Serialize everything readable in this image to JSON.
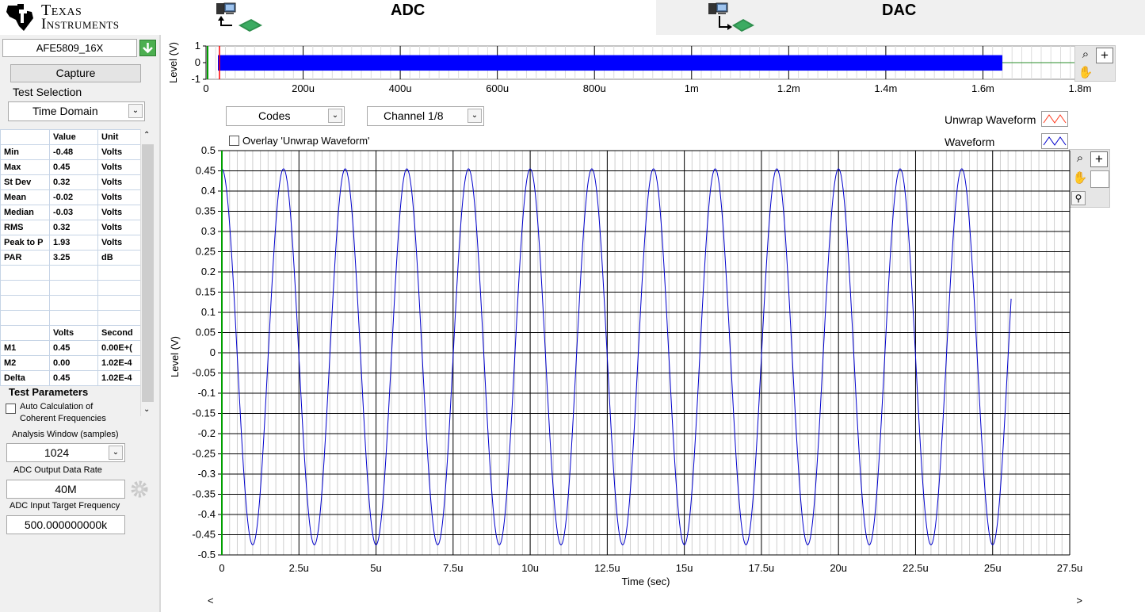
{
  "header": {
    "logo_line1": "Texas",
    "logo_line2": "Instruments",
    "tab_adc": "ADC",
    "tab_dac": "DAC"
  },
  "left_panel": {
    "device": "AFE5809_16X",
    "capture_label": "Capture",
    "test_selection_label": "Test Selection",
    "test_selection_value": "Time Domain",
    "stats_headers": [
      "",
      "Value",
      "Unit"
    ],
    "stats_rows": [
      {
        "name": "Min",
        "value": "-0.48",
        "unit": "Volts"
      },
      {
        "name": "Max",
        "value": "0.45",
        "unit": "Volts"
      },
      {
        "name": "St Dev",
        "value": "0.32",
        "unit": "Volts"
      },
      {
        "name": "Mean",
        "value": "-0.02",
        "unit": "Volts"
      },
      {
        "name": "Median",
        "value": "-0.03",
        "unit": "Volts"
      },
      {
        "name": "RMS",
        "value": "0.32",
        "unit": "Volts"
      },
      {
        "name": "Peak to P",
        "value": "1.93",
        "unit": "Volts"
      },
      {
        "name": "PAR",
        "value": "3.25",
        "unit": "dB"
      }
    ],
    "marker_headers": [
      "",
      "Volts",
      "Second"
    ],
    "marker_rows": [
      {
        "name": "M1",
        "value": "0.45",
        "unit": "0.00E+("
      },
      {
        "name": "M2",
        "value": "0.00",
        "unit": "1.02E-4"
      },
      {
        "name": "Delta",
        "value": "0.45",
        "unit": "1.02E-4"
      }
    ],
    "test_parameters_label": "Test Parameters",
    "auto_calc_line1": "Auto Calculation of",
    "auto_calc_line2": "Coherent Frequencies",
    "analysis_window_label": "Analysis Window (samples)",
    "analysis_window_value": "1024",
    "adc_rate_label": "ADC Output Data Rate",
    "adc_rate_value": "40M",
    "adc_target_label": "ADC Input Target Frequency",
    "adc_target_value": "500.000000000k"
  },
  "controls": {
    "codes_value": "Codes",
    "channel_value": "Channel 1/8",
    "overlay_label": "Overlay 'Unwrap Waveform'",
    "legend_unwrap": "Unwrap Waveform",
    "legend_waveform": "Waveform",
    "unwrap_color": "#ff3b1f",
    "waveform_color": "#0000cc"
  },
  "chart_data": [
    {
      "type": "line",
      "title": "",
      "ylabel": "Level (V)",
      "xlim": [
        0,
        0.0018
      ],
      "ylim": [
        -1,
        1
      ],
      "x_ticks": [
        "0",
        "200u",
        "400u",
        "600u",
        "800u",
        "1m",
        "1.2m",
        "1.4m",
        "1.6m",
        "1.8m"
      ],
      "y_ticks": [
        "1",
        "0",
        "-1"
      ],
      "series": [
        {
          "values_summary": "dense waveform band from 0 to ~1.64m spanning about -0.48 to 0.45"
        }
      ],
      "data_end_x": 0.00164,
      "color": "#0000ff"
    },
    {
      "type": "line",
      "title": "",
      "xlabel": "Time (sec)",
      "ylabel": "Level (V)",
      "xlim": [
        0,
        2.75e-05
      ],
      "ylim": [
        -0.5,
        0.5
      ],
      "x_ticks": [
        "0",
        "2.5u",
        "5u",
        "7.5u",
        "10u",
        "12.5u",
        "15u",
        "17.5u",
        "20u",
        "22.5u",
        "25u",
        "27.5u"
      ],
      "y_ticks": [
        "0.5",
        "0.45",
        "0.4",
        "0.35",
        "0.3",
        "0.25",
        "0.2",
        "0.15",
        "0.1",
        "0.05",
        "0",
        "-0.05",
        "-0.1",
        "-0.15",
        "-0.2",
        "-0.25",
        "-0.3",
        "-0.35",
        "-0.4",
        "-0.45",
        "-0.5"
      ],
      "grid": true,
      "series": [
        {
          "name": "Waveform",
          "frequency_hz": 500000,
          "amplitude": 0.465,
          "offset": -0.01,
          "start_value": 0.45,
          "x_end": 2.56e-05
        }
      ]
    }
  ]
}
